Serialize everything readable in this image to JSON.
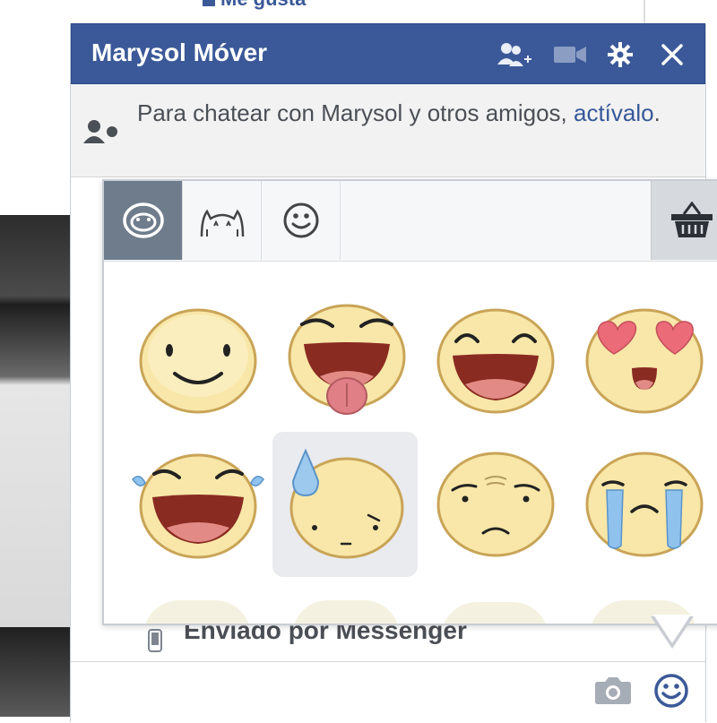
{
  "background": {
    "top_link": "Me gusta"
  },
  "chat": {
    "title": "Marysol Móver",
    "notice_text": "Para chatear con Marysol y otros amigos, ",
    "notice_link": "actívalo",
    "notice_end": ".",
    "sent_via": "Enviado por Messenger",
    "header_icons": [
      "add-friends-icon",
      "video-call-icon",
      "gear-icon",
      "close-icon"
    ],
    "composer_icons": [
      "camera-icon",
      "smiley-icon"
    ]
  },
  "sticker_picker": {
    "tabs": [
      "sticker-face-tab",
      "cat-sticker-tab",
      "emoji-tab"
    ],
    "active_tab": 0,
    "store_icon": "basket-icon",
    "stickers": [
      {
        "name": "smile-sticker"
      },
      {
        "name": "tongue-out-sticker"
      },
      {
        "name": "laughing-sticker"
      },
      {
        "name": "heart-eyes-sticker"
      },
      {
        "name": "tears-of-joy-sticker"
      },
      {
        "name": "sweat-drop-sticker",
        "hovered": true
      },
      {
        "name": "worried-sticker"
      },
      {
        "name": "crying-sticker"
      }
    ],
    "colors": {
      "face": "#f8e7a8",
      "face_edge": "#c9a457",
      "accent": "#3b5998"
    }
  }
}
